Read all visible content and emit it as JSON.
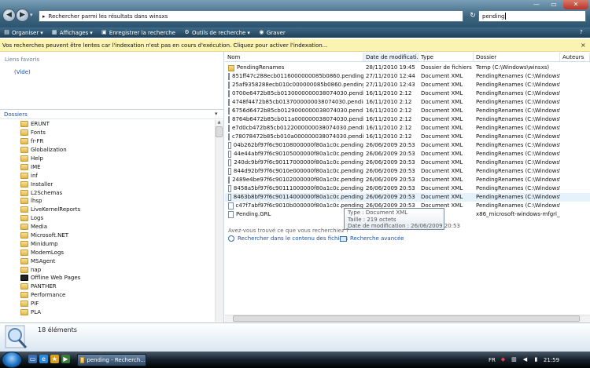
{
  "address": {
    "path": "Rechercher parmi les résultats dans winsxs",
    "nav_back": "◀",
    "nav_forward": "▶",
    "dropdown": "▾"
  },
  "search": {
    "query": "pending"
  },
  "window": {
    "minimize": "—",
    "maximize": "▭",
    "close": "✕"
  },
  "toolbar": {
    "organize": "Organiser",
    "views": "Affichages",
    "save_search": "Enregistrer la recherche",
    "search_tools": "Outils de recherche",
    "burn": "Graver",
    "help": "?"
  },
  "infobar": {
    "text": "Vos recherches peuvent être lentes car l'indexation n'est pas en cours d'exécution. Cliquez pour activer l'indexation...",
    "close": "×"
  },
  "left_pane": {
    "favorites_title": "Liens favoris",
    "favorites_empty": "(Vide)",
    "folders_title": "Dossiers",
    "folders": [
      {
        "name": "ERUNT",
        "icon": "folder"
      },
      {
        "name": "Fonts",
        "icon": "folder"
      },
      {
        "name": "fr-FR",
        "icon": "folder"
      },
      {
        "name": "Globalization",
        "icon": "folder"
      },
      {
        "name": "Help",
        "icon": "folder"
      },
      {
        "name": "IME",
        "icon": "folder"
      },
      {
        "name": "inf",
        "icon": "folder"
      },
      {
        "name": "Installer",
        "icon": "folder"
      },
      {
        "name": "L2Schemas",
        "icon": "folder"
      },
      {
        "name": "lhsp",
        "icon": "folder"
      },
      {
        "name": "LiveKernelReports",
        "icon": "folder"
      },
      {
        "name": "Logs",
        "icon": "folder"
      },
      {
        "name": "Media",
        "icon": "folder"
      },
      {
        "name": "Microsoft.NET",
        "icon": "folder"
      },
      {
        "name": "Minidump",
        "icon": "folder"
      },
      {
        "name": "ModemLogs",
        "icon": "folder"
      },
      {
        "name": "MSAgent",
        "icon": "folder"
      },
      {
        "name": "nap",
        "icon": "folder"
      },
      {
        "name": "Offline Web Pages",
        "icon": "offline"
      },
      {
        "name": "PANTHER",
        "icon": "folder"
      },
      {
        "name": "Performance",
        "icon": "folder"
      },
      {
        "name": "PIF",
        "icon": "folder"
      },
      {
        "name": "PLA",
        "icon": "folder"
      }
    ]
  },
  "columns": [
    "Nom",
    "Date de modificati...",
    "Type",
    "Dossier",
    "Auteurs"
  ],
  "files": [
    {
      "name": "PendingRenames",
      "date": "28/11/2010 19:45",
      "type": "Dossier de fichiers",
      "folder": "Temp (C:\\Windows\\winsxs)",
      "icon": "folder"
    },
    {
      "name": "851ff47c288ecb0116000000085b0860.pending",
      "date": "27/11/2010 12:44",
      "type": "Document XML",
      "folder": "PendingRenames (C:\\Windows\\w...",
      "icon": "xml"
    },
    {
      "name": "25af9358288ecb010c000000085b0860.pending",
      "date": "27/11/2010 12:43",
      "type": "Document XML",
      "folder": "PendingRenames (C:\\Windows\\w...",
      "icon": "xml"
    },
    {
      "name": "0700e6472b85cb0130000000038074030.pending",
      "date": "16/11/2010 2:12",
      "type": "Document XML",
      "folder": "PendingRenames (C:\\Windows\\w...",
      "icon": "xml"
    },
    {
      "name": "4748f4472b85cb0137000000038074030.pending",
      "date": "16/11/2010 2:12",
      "type": "Document XML",
      "folder": "PendingRenames (C:\\Windows\\w...",
      "icon": "xml"
    },
    {
      "name": "6756d6472b85cb0129000000038074030.pending",
      "date": "16/11/2010 2:12",
      "type": "Document XML",
      "folder": "PendingRenames (C:\\Windows\\w...",
      "icon": "xml"
    },
    {
      "name": "8764b6472b85cb011a000000038074030.pending",
      "date": "16/11/2010 2:12",
      "type": "Document XML",
      "folder": "PendingRenames (C:\\Windows\\w...",
      "icon": "xml"
    },
    {
      "name": "e7d0cb472b85cb0122000000038074030.pending",
      "date": "16/11/2010 2:12",
      "type": "Document XML",
      "folder": "PendingRenames (C:\\Windows\\w...",
      "icon": "xml"
    },
    {
      "name": "c78078472b85cb010a000000038074030.pending",
      "date": "16/11/2010 2:12",
      "type": "Document XML",
      "folder": "PendingRenames (C:\\Windows\\w...",
      "icon": "xml"
    },
    {
      "name": "04b262bf97f6c90108000000f80a1c0c.pending",
      "date": "26/06/2009 20:53",
      "type": "Document XML",
      "folder": "PendingRenames (C:\\Windows\\w...",
      "icon": "xml"
    },
    {
      "name": "44e44abf97f6c90105000000f80a1c0c.pending",
      "date": "26/06/2009 20:53",
      "type": "Document XML",
      "folder": "PendingRenames (C:\\Windows\\w...",
      "icon": "xml"
    },
    {
      "name": "240dc9bf97f6c90117000000f80a1c0c.pending",
      "date": "26/06/2009 20:53",
      "type": "Document XML",
      "folder": "PendingRenames (C:\\Windows\\w...",
      "icon": "xml"
    },
    {
      "name": "844d92bf97f6c9010e000000f80a1c0c.pending",
      "date": "26/06/2009 20:53",
      "type": "Document XML",
      "folder": "PendingRenames (C:\\Windows\\w...",
      "icon": "xml"
    },
    {
      "name": "2489e4be97f6c90102000000f80a1c0c.pending",
      "date": "26/06/2009 20:53",
      "type": "Document XML",
      "folder": "PendingRenames (C:\\Windows\\w...",
      "icon": "xml"
    },
    {
      "name": "8458a5bf97f6c90111000000f80a1c0c.pending",
      "date": "26/06/2009 20:53",
      "type": "Document XML",
      "folder": "PendingRenames (C:\\Windows\\w...",
      "icon": "xml"
    },
    {
      "name": "8463b8bf97f6c90114000000f80a1c0c.pending",
      "date": "26/06/2009 20:53",
      "type": "Document XML",
      "folder": "PendingRenames (C:\\Windows\\w...",
      "icon": "xml",
      "selected": true
    },
    {
      "name": "c47f7abf97f6c9010b000000f80a1c0c.pending",
      "date": "26/06/2009 20:53",
      "type": "Document XML",
      "folder": "PendingRenames (C:\\Windows\\w...",
      "icon": "xml"
    },
    {
      "name": "Pending.GRL",
      "date": "",
      "type": "",
      "folder": "x86_microsoft-windows-mfgrl_31...",
      "icon": "file"
    }
  ],
  "tooltip": {
    "type": "Type : Document XML",
    "size": "Taille : 219 octets",
    "modified": "Date de modification : 26/06/2009 20:53"
  },
  "footer": {
    "question": "Avez-vous trouvé ce que vous recherchiez ?",
    "search_contents": "Rechercher dans le contenu des fichiers",
    "advanced": "Recherche avancée"
  },
  "details": {
    "count": "18 éléments"
  },
  "taskbar": {
    "window_label": "pending - Recherch...",
    "lang": "FR",
    "time": "21:59"
  },
  "colors": {
    "accent": "#1b4fa8",
    "infobar": "#fbf3b2",
    "selection": "#e5f1fb"
  }
}
